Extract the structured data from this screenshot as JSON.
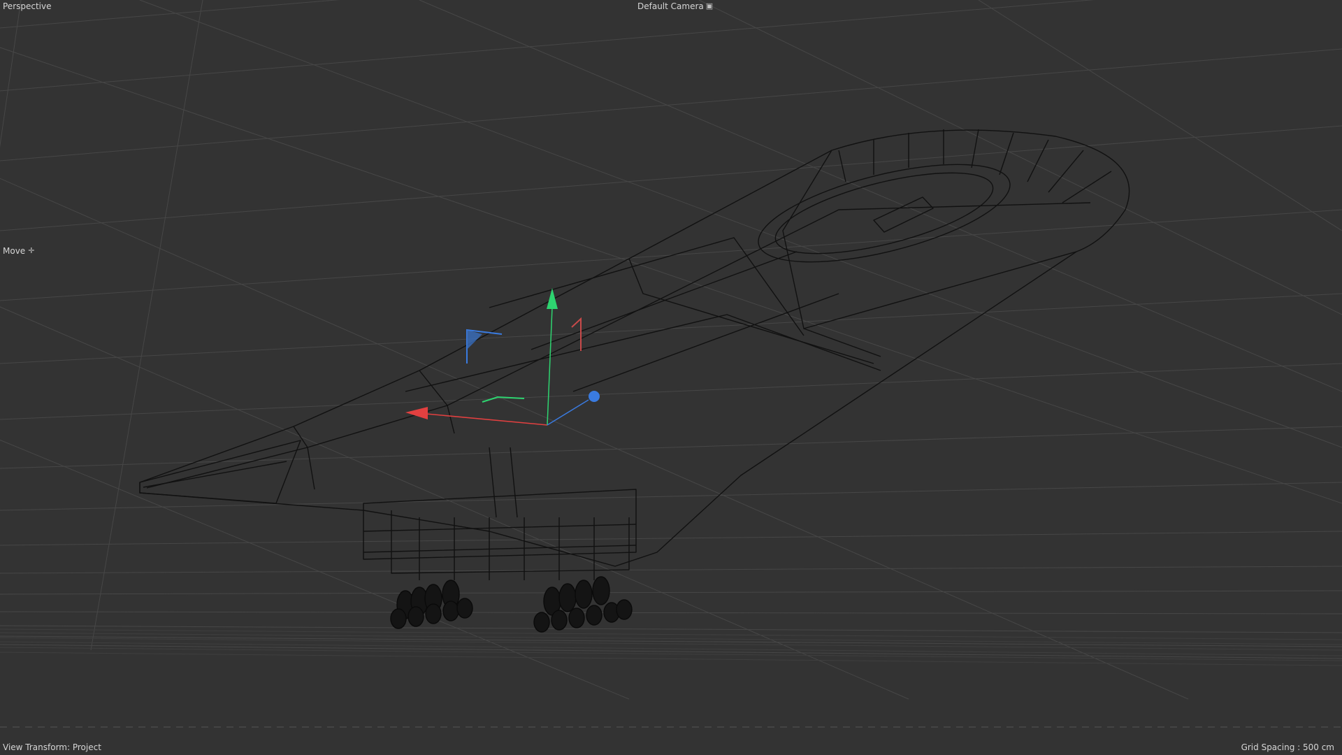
{
  "viewport": {
    "view_name": "Perspective",
    "camera_name": "Default Camera",
    "camera_icon": "camera-icon",
    "active_tool": "Move",
    "tool_icon": "move-icon",
    "view_transform": "View Transform: Project",
    "grid_spacing": "Grid Spacing : 500 cm"
  },
  "colors": {
    "background": "#333333",
    "grid": "#4a4a4a",
    "wireframe": "#0d0d0d",
    "axis_x": "#e34040",
    "axis_y": "#2ed470",
    "axis_z": "#3a7be0"
  }
}
